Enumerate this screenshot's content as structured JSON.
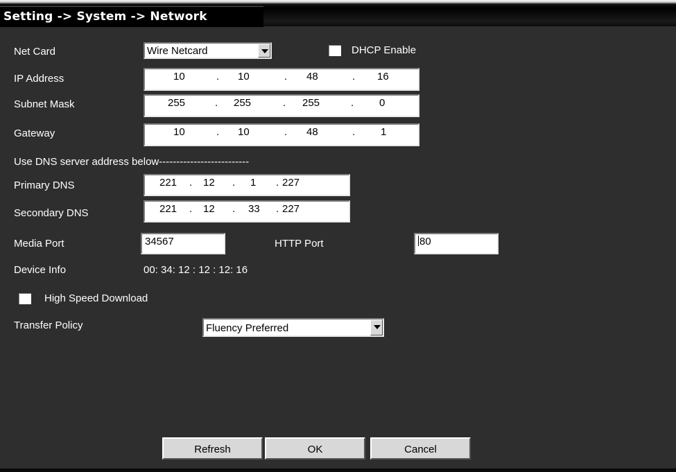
{
  "breadcrumb": "Setting -> System -> Network",
  "net_card": {
    "label": "Net Card",
    "selected": "Wire Netcard"
  },
  "dhcp": {
    "label": "DHCP Enable",
    "checked": false
  },
  "ip_address": {
    "label": "IP Address",
    "octets": [
      "10",
      "10",
      "48",
      "16"
    ]
  },
  "subnet_mask": {
    "label": "Subnet Mask",
    "octets": [
      "255",
      "255",
      "255",
      "0"
    ]
  },
  "gateway": {
    "label": "Gateway",
    "octets": [
      "10",
      "10",
      "48",
      "1"
    ]
  },
  "dns_note": "Use DNS server address below--------------------------",
  "primary_dns": {
    "label": "Primary DNS",
    "octets": [
      "221",
      "12",
      "1",
      "227"
    ]
  },
  "secondary_dns": {
    "label": "Secondary DNS",
    "octets": [
      "221",
      "12",
      "33",
      "227"
    ]
  },
  "media_port": {
    "label": "Media Port",
    "value": "34567"
  },
  "http_port": {
    "label": "HTTP Port",
    "value": "80"
  },
  "device_info": {
    "label": "Device Info",
    "value": "00: 34: 12 : 12 : 12: 16"
  },
  "high_speed": {
    "label": "High Speed Download",
    "checked": false
  },
  "transfer_policy": {
    "label": "Transfer Policy",
    "selected": "Fluency Preferred"
  },
  "buttons": {
    "refresh": "Refresh",
    "ok": "OK",
    "cancel": "Cancel"
  },
  "separator": "."
}
